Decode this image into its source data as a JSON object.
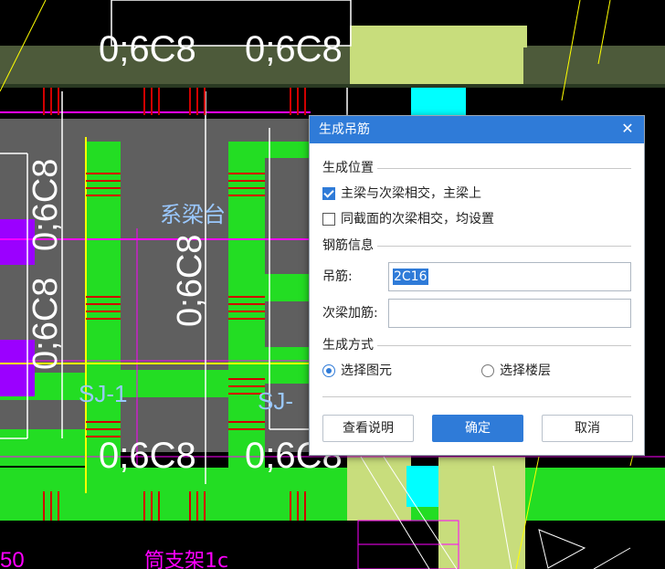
{
  "cad": {
    "labels": {
      "rebar_top_left": "0;6C8",
      "rebar_top_right": "0;6C8",
      "rebar_left_vertical": "0;6C8",
      "rebar_left_vertical_lower": "0;6C8",
      "rebar_center_vertical": "0;6C8",
      "rebar_center_vertical_2": "0;6C8",
      "rebar_bottom_left": "0;6C8",
      "rebar_bottom_right": "0;6C8",
      "beam_tag_left": "SJ-1",
      "beam_tag_right": "SJ-",
      "cap_label": "系梁台",
      "bottom_left_num": "50",
      "bottom_magenta_text": "筒支架1c"
    },
    "colors": {
      "background": "#000000",
      "green": "#23dd23",
      "gray": "#636363",
      "red": "#d00000",
      "magenta": "#ff00ff",
      "yellow": "#ffff00",
      "olive": "#c8dd7c",
      "cyan": "#00ffff",
      "purple": "#9b00ff",
      "white": "#ffffff"
    }
  },
  "dialog": {
    "title": "生成吊筋",
    "close_glyph": "✕",
    "section_position": "生成位置",
    "option_main_secondary": {
      "label": "主梁与次梁相交，主梁上",
      "checked": true
    },
    "option_same_section": {
      "label": "同截面的次梁相交，均设置",
      "checked": false
    },
    "section_rebar": "钢筋信息",
    "hanger_label": "吊筋:",
    "hanger_value": "2C16",
    "secondary_label": "次梁加筋:",
    "secondary_value": "",
    "section_method": "生成方式",
    "radio_select_element": {
      "label": "选择图元",
      "selected": true
    },
    "radio_select_floor": {
      "label": "选择楼层",
      "selected": false
    },
    "btn_help": "查看说明",
    "btn_ok": "确定",
    "btn_cancel": "取消"
  }
}
